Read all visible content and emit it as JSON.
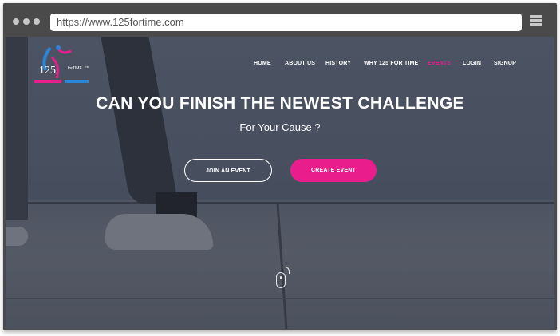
{
  "browser": {
    "url": "https://www.125fortime.com",
    "menu_icon": "hamburger-menu-icon"
  },
  "logo": {
    "number": "125",
    "tagline": "forTIME",
    "trademark": "TM"
  },
  "nav": {
    "items": [
      {
        "label": "HOME",
        "active": false
      },
      {
        "label": "ABOUT US",
        "active": false
      },
      {
        "label": "HISTORY",
        "active": false
      },
      {
        "label": "WHY 125 FOR TIME",
        "active": false
      },
      {
        "label": "EVENTS",
        "active": true
      },
      {
        "label": "LOGIN",
        "active": false
      },
      {
        "label": "SIGNUP",
        "active": false
      }
    ]
  },
  "hero": {
    "headline": "CAN YOU FINISH THE NEWEST CHALLENGE",
    "subheadline": "For Your Cause ?",
    "join_button": "JOIN AN EVENT",
    "create_button": "CREATE EVENT",
    "scroll_icon": "mouse-scroll-icon"
  },
  "colors": {
    "accent": "#e91e8c",
    "window_frame": "#4a4a4a",
    "text": "#ffffff"
  }
}
